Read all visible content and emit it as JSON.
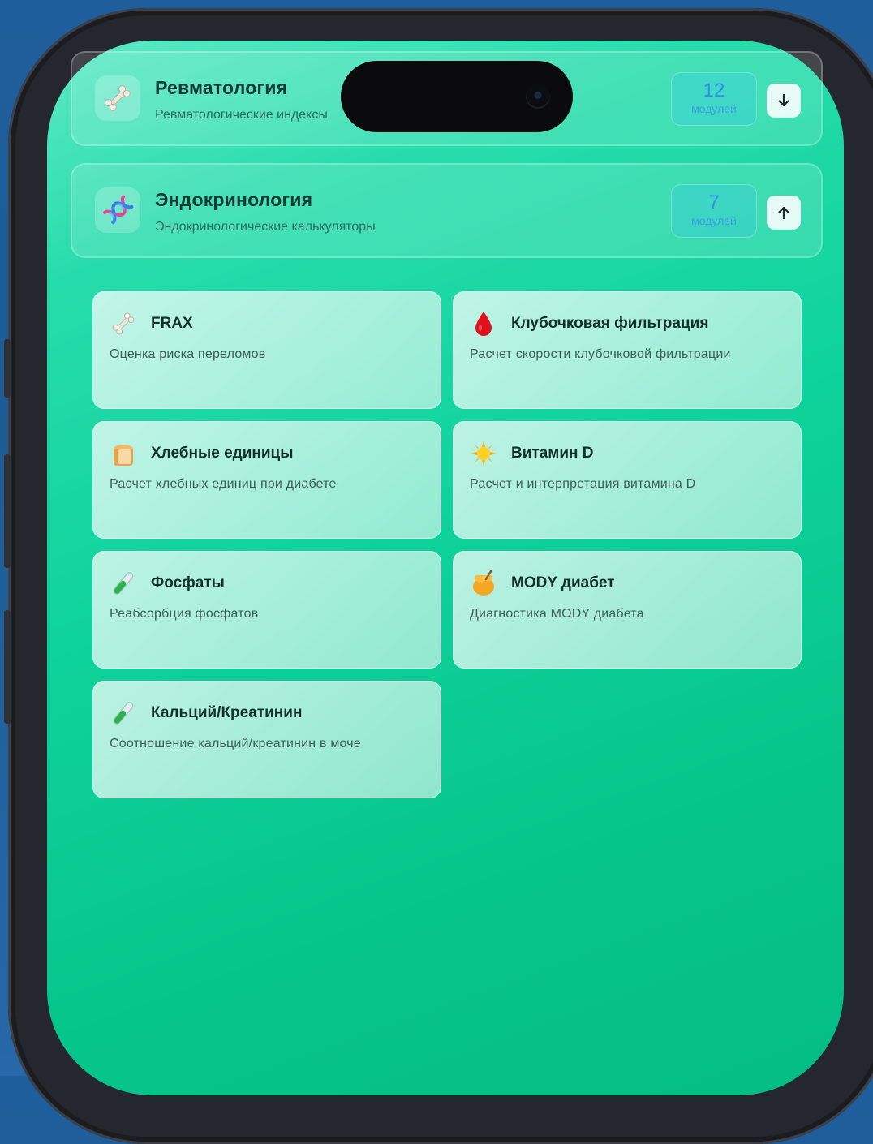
{
  "sections": [
    {
      "title": "Ревматология",
      "subtitle": "Ревматологические индексы",
      "count": "12",
      "count_label": "модулей",
      "icon": "bone-icon",
      "expanded": false
    },
    {
      "title": "Эндокринология",
      "subtitle": "Эндокринологические калькуляторы",
      "count": "7",
      "count_label": "модулей",
      "icon": "dna-icon",
      "expanded": true
    }
  ],
  "modules": [
    {
      "title": "FRAX",
      "description": "Оценка риска переломов",
      "icon": "bone-icon"
    },
    {
      "title": "Клубочковая фильтрация",
      "description": "Расчет скорости клубочковой фильтрации",
      "icon": "blood-drop-icon"
    },
    {
      "title": "Хлебные единицы",
      "description": "Расчет хлебных единиц при диабете",
      "icon": "bread-icon"
    },
    {
      "title": "Витамин D",
      "description": "Расчет и интерпретация витамина D",
      "icon": "sun-icon"
    },
    {
      "title": "Фосфаты",
      "description": "Реабсорбция фосфатов",
      "icon": "test-tube-icon"
    },
    {
      "title": "MODY диабет",
      "description": "Диагностика MODY диабета",
      "icon": "honey-pot-icon"
    },
    {
      "title": "Кальций/Креатинин",
      "description": "Соотношение кальций/креатинин в моче",
      "icon": "test-tube-icon"
    }
  ],
  "colors": {
    "screen_gradient_top": "#5ee9c5",
    "screen_gradient_bottom": "#04bd84",
    "badge_text": "#2f8fe8",
    "outer_background": "#1f5e9c"
  }
}
